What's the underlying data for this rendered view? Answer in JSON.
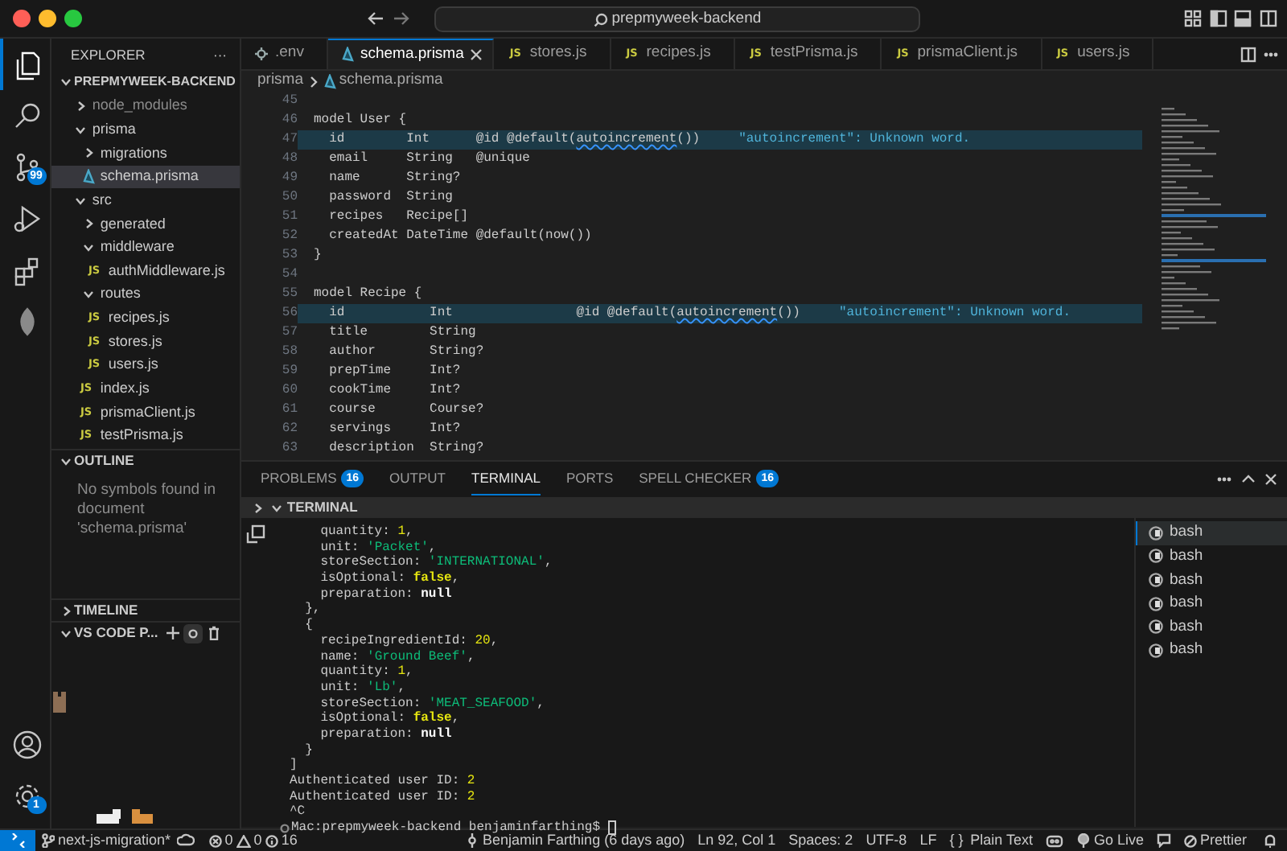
{
  "titlebar": {
    "search": "prepmyweek-backend"
  },
  "activity_bar": {
    "items": [
      {
        "kind": "explorer",
        "selected": true
      },
      {
        "kind": "search",
        "selected": false
      },
      {
        "kind": "source-control",
        "selected": false,
        "badge": "99"
      },
      {
        "kind": "run",
        "selected": false
      },
      {
        "kind": "extensions",
        "selected": false
      },
      {
        "kind": "leaf",
        "selected": false
      }
    ],
    "bottom": [
      {
        "kind": "account"
      },
      {
        "kind": "settings",
        "badge": "1"
      }
    ]
  },
  "sidebar": {
    "title": "EXPLORER",
    "more": "···",
    "project": {
      "label": "PREPMYWEEK-BACKEND",
      "expanded": true,
      "children": [
        {
          "label": "node_modules",
          "kind": "folder",
          "expanded": false,
          "selected": false,
          "ignored": true
        },
        {
          "label": "prisma",
          "kind": "folder",
          "expanded": true,
          "selected": false,
          "ignored": false,
          "children": [
            {
              "label": "migrations",
              "kind": "folder",
              "expanded": false,
              "selected": false,
              "ignored": false
            },
            {
              "label": "schema.prisma",
              "kind": "prisma",
              "selected": true,
              "ignored": false
            }
          ]
        },
        {
          "label": "src",
          "kind": "folder",
          "expanded": true,
          "selected": false,
          "ignored": false,
          "children": [
            {
              "label": "generated",
              "kind": "folder",
              "expanded": false,
              "selected": false,
              "ignored": false
            },
            {
              "label": "middleware",
              "kind": "folder",
              "expanded": true,
              "selected": false,
              "ignored": false,
              "children": [
                {
                  "label": "authMiddleware.js",
                  "kind": "js",
                  "icon_text": "JS",
                  "selected": false,
                  "ignored": false
                }
              ]
            },
            {
              "label": "routes",
              "kind": "folder",
              "expanded": true,
              "selected": false,
              "ignored": false,
              "children": [
                {
                  "label": "recipes.js",
                  "kind": "js",
                  "icon_text": "JS",
                  "selected": false,
                  "ignored": false
                },
                {
                  "label": "stores.js",
                  "kind": "js",
                  "icon_text": "JS",
                  "selected": false,
                  "ignored": false
                },
                {
                  "label": "users.js",
                  "kind": "js",
                  "icon_text": "JS",
                  "selected": false,
                  "ignored": false
                }
              ]
            },
            {
              "label": "index.js",
              "kind": "js",
              "icon_text": "JS",
              "selected": false,
              "ignored": false
            },
            {
              "label": "prismaClient.js",
              "kind": "js",
              "icon_text": "JS",
              "selected": false,
              "ignored": false
            },
            {
              "label": "testPrisma.js",
              "kind": "js",
              "icon_text": "JS",
              "selected": false,
              "ignored": false
            }
          ]
        }
      ]
    },
    "outline": {
      "title": "OUTLINE",
      "expanded": true,
      "message": "No symbols found in document 'schema.prisma'"
    },
    "timeline": {
      "title": "TIMELINE",
      "expanded": false
    },
    "pets": {
      "title": "VS CODE P...",
      "expanded": true
    }
  },
  "editor": {
    "tabs": [
      {
        "label": ".env",
        "kind": "env",
        "selected": false
      },
      {
        "label": "schema.prisma",
        "kind": "prisma",
        "selected": true
      },
      {
        "label": "stores.js",
        "kind": "js",
        "icon_text": "JS",
        "selected": false
      },
      {
        "label": "recipes.js",
        "kind": "js",
        "icon_text": "JS",
        "selected": false
      },
      {
        "label": "testPrisma.js",
        "kind": "js",
        "icon_text": "JS",
        "selected": false
      },
      {
        "label": "prismaClient.js",
        "kind": "js",
        "icon_text": "JS",
        "selected": false
      },
      {
        "label": "users.js",
        "kind": "js",
        "icon_text": "JS",
        "selected": false
      }
    ],
    "breadcrumb": [
      {
        "label": "prisma",
        "kind": "folder"
      },
      {
        "label": "schema.prisma",
        "kind": "prisma"
      }
    ],
    "lines": [
      {
        "number": "45",
        "highlighted": false
      },
      {
        "number": "46",
        "highlighted": false,
        "parts": [
          {
            "text": "model User {",
            "kind": "plain"
          }
        ]
      },
      {
        "number": "47",
        "highlighted": true,
        "parts": [
          {
            "text": "  id        Int      @id @default(",
            "kind": "plain"
          },
          {
            "text": "autoincrement",
            "kind": "squiggle"
          },
          {
            "text": "())",
            "kind": "plain"
          }
        ],
        "hint": "\"autoincrement\": Unknown word."
      },
      {
        "number": "48",
        "highlighted": false,
        "parts": [
          {
            "text": "  email     String   @unique",
            "kind": "plain"
          }
        ]
      },
      {
        "number": "49",
        "highlighted": false,
        "parts": [
          {
            "text": "  name      String?",
            "kind": "plain"
          }
        ]
      },
      {
        "number": "50",
        "highlighted": false,
        "parts": [
          {
            "text": "  password  String",
            "kind": "plain"
          }
        ]
      },
      {
        "number": "51",
        "highlighted": false,
        "parts": [
          {
            "text": "  recipes   Recipe[]",
            "kind": "plain"
          }
        ]
      },
      {
        "number": "52",
        "highlighted": false,
        "parts": [
          {
            "text": "  createdAt DateTime @default(now())",
            "kind": "plain"
          }
        ]
      },
      {
        "number": "53",
        "highlighted": false,
        "parts": [
          {
            "text": "}",
            "kind": "plain"
          }
        ]
      },
      {
        "number": "54",
        "highlighted": false
      },
      {
        "number": "55",
        "highlighted": false,
        "parts": [
          {
            "text": "model Recipe {",
            "kind": "plain"
          }
        ]
      },
      {
        "number": "56",
        "highlighted": true,
        "parts": [
          {
            "text": "  id           Int                @id @default(",
            "kind": "plain"
          },
          {
            "text": "autoincrement",
            "kind": "squiggle"
          },
          {
            "text": "())",
            "kind": "plain"
          }
        ],
        "hint": "\"autoincrement\": Unknown word."
      },
      {
        "number": "57",
        "highlighted": false,
        "parts": [
          {
            "text": "  title        String",
            "kind": "plain"
          }
        ]
      },
      {
        "number": "58",
        "highlighted": false,
        "parts": [
          {
            "text": "  author       String?",
            "kind": "plain"
          }
        ]
      },
      {
        "number": "59",
        "highlighted": false,
        "parts": [
          {
            "text": "  prepTime     Int?",
            "kind": "plain"
          }
        ]
      },
      {
        "number": "60",
        "highlighted": false,
        "parts": [
          {
            "text": "  cookTime     Int?",
            "kind": "plain"
          }
        ]
      },
      {
        "number": "61",
        "highlighted": false,
        "parts": [
          {
            "text": "  course       Course?",
            "kind": "plain"
          }
        ]
      },
      {
        "number": "62",
        "highlighted": false,
        "parts": [
          {
            "text": "  servings     Int?",
            "kind": "plain"
          }
        ]
      },
      {
        "number": "63",
        "highlighted": false,
        "parts": [
          {
            "text": "  description  String?",
            "kind": "plain"
          }
        ]
      }
    ]
  },
  "panel": {
    "tabs": [
      {
        "label": "PROBLEMS",
        "selected": false,
        "badge": "16"
      },
      {
        "label": "OUTPUT",
        "selected": false
      },
      {
        "label": "TERMINAL",
        "selected": true
      },
      {
        "label": "PORTS",
        "selected": false
      },
      {
        "label": "SPELL CHECKER",
        "selected": false,
        "badge": "16"
      }
    ],
    "terminal_title": "TERMINAL",
    "lines": [
      {
        "kind": "output",
        "parts": [
          {
            "text": "    quantity: ",
            "kind": "plain"
          },
          {
            "text": "1",
            "kind": "number"
          },
          {
            "text": ",",
            "kind": "plain"
          }
        ]
      },
      {
        "kind": "output",
        "parts": [
          {
            "text": "    unit: ",
            "kind": "plain"
          },
          {
            "text": "'Packet'",
            "kind": "string"
          },
          {
            "text": ",",
            "kind": "plain"
          }
        ]
      },
      {
        "kind": "output",
        "parts": [
          {
            "text": "    storeSection: ",
            "kind": "plain"
          },
          {
            "text": "'INTERNATIONAL'",
            "kind": "string"
          },
          {
            "text": ",",
            "kind": "plain"
          }
        ]
      },
      {
        "kind": "output",
        "parts": [
          {
            "text": "    isOptional: ",
            "kind": "plain"
          },
          {
            "text": "false",
            "kind": "boolean"
          },
          {
            "text": ",",
            "kind": "plain"
          }
        ]
      },
      {
        "kind": "output",
        "parts": [
          {
            "text": "    preparation: ",
            "kind": "plain"
          },
          {
            "text": "null",
            "kind": "null"
          }
        ]
      },
      {
        "kind": "output",
        "parts": [
          {
            "text": "  },",
            "kind": "plain"
          }
        ]
      },
      {
        "kind": "output",
        "parts": [
          {
            "text": "  {",
            "kind": "plain"
          }
        ]
      },
      {
        "kind": "output",
        "parts": [
          {
            "text": "    recipeIngredientId: ",
            "kind": "plain"
          },
          {
            "text": "20",
            "kind": "number"
          },
          {
            "text": ",",
            "kind": "plain"
          }
        ]
      },
      {
        "kind": "output",
        "parts": [
          {
            "text": "    name: ",
            "kind": "plain"
          },
          {
            "text": "'Ground Beef'",
            "kind": "string"
          },
          {
            "text": ",",
            "kind": "plain"
          }
        ]
      },
      {
        "kind": "output",
        "parts": [
          {
            "text": "    quantity: ",
            "kind": "plain"
          },
          {
            "text": "1",
            "kind": "number"
          },
          {
            "text": ",",
            "kind": "plain"
          }
        ]
      },
      {
        "kind": "output",
        "parts": [
          {
            "text": "    unit: ",
            "kind": "plain"
          },
          {
            "text": "'Lb'",
            "kind": "string"
          },
          {
            "text": ",",
            "kind": "plain"
          }
        ]
      },
      {
        "kind": "output",
        "parts": [
          {
            "text": "    storeSection: ",
            "kind": "plain"
          },
          {
            "text": "'MEAT_SEAFOOD'",
            "kind": "string"
          },
          {
            "text": ",",
            "kind": "plain"
          }
        ]
      },
      {
        "kind": "output",
        "parts": [
          {
            "text": "    isOptional: ",
            "kind": "plain"
          },
          {
            "text": "false",
            "kind": "boolean"
          },
          {
            "text": ",",
            "kind": "plain"
          }
        ]
      },
      {
        "kind": "output",
        "parts": [
          {
            "text": "    preparation: ",
            "kind": "plain"
          },
          {
            "text": "null",
            "kind": "null"
          }
        ]
      },
      {
        "kind": "output",
        "parts": [
          {
            "text": "  }",
            "kind": "plain"
          }
        ]
      },
      {
        "kind": "output",
        "parts": [
          {
            "text": "]",
            "kind": "plain"
          }
        ]
      },
      {
        "kind": "output",
        "parts": [
          {
            "text": "Authenticated user ID: ",
            "kind": "plain"
          },
          {
            "text": "2",
            "kind": "number"
          }
        ]
      },
      {
        "kind": "output",
        "parts": [
          {
            "text": "Authenticated user ID: ",
            "kind": "plain"
          },
          {
            "text": "2",
            "kind": "number"
          }
        ]
      },
      {
        "kind": "output",
        "parts": [
          {
            "text": "^C",
            "kind": "plain"
          }
        ]
      },
      {
        "kind": "prompt",
        "parts": [
          {
            "text": "Mac:prepmyweek-backend benjaminfarthing$ ",
            "kind": "plain"
          }
        ]
      }
    ],
    "shells": [
      {
        "label": "bash",
        "selected": true
      },
      {
        "label": "bash",
        "selected": false
      },
      {
        "label": "bash",
        "selected": false
      },
      {
        "label": "bash",
        "selected": false
      },
      {
        "label": "bash",
        "selected": false
      },
      {
        "label": "bash",
        "selected": false
      }
    ]
  },
  "status_bar": {
    "branch": "next-js-migration*",
    "errors": "0",
    "warnings": "0",
    "infos": "16",
    "author": "Benjamin Farthing (6 days ago)",
    "position": "Ln 92, Col 1",
    "indent": "Spaces: 2",
    "encoding": "UTF-8",
    "eol": "LF",
    "language_icon": "{ }",
    "language": "Plain Text",
    "live": "Go Live",
    "formatter": "Prettier"
  }
}
